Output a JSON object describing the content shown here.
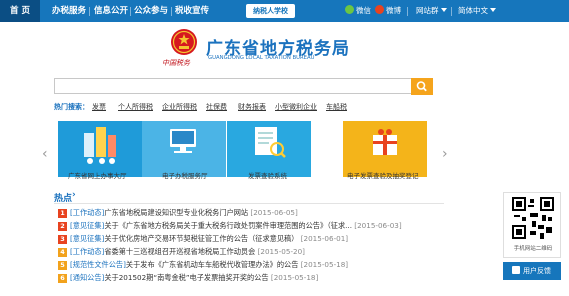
{
  "nav": {
    "items": [
      {
        "label": "首 页"
      },
      {
        "label": "办税服务"
      },
      {
        "label": "信息公开"
      },
      {
        "label": "公众参与"
      },
      {
        "label": "税收宣传"
      }
    ],
    "badge": "纳税人学校",
    "wechat": "微信",
    "weibo": "微博",
    "site_group": "网站群",
    "lang": "简体中文"
  },
  "logo": {
    "title_cn": "广东省地方税务局",
    "title_en": "GUANGDONG LOCAL TAXATION BUREAU",
    "brush": "中国税务"
  },
  "search": {
    "value": "",
    "icon": "search-icon"
  },
  "hot_search": {
    "label": "热门搜索：",
    "links": [
      "发票",
      "个人所得税",
      "企业所得税",
      "社保费",
      "财务报表",
      "小型微利企业",
      "车船税"
    ]
  },
  "tiles": [
    {
      "caption": "广东省网上办事大厅",
      "color": "#1f9bd9"
    },
    {
      "caption": "电子办税服务厅",
      "color": "#4bb4e6"
    },
    {
      "caption": "发票查验系统",
      "color": "#29a8e0"
    },
    {
      "caption": "电子发票查验及抽奖登记",
      "color": "#f4b41a"
    }
  ],
  "news": {
    "heading": "热点",
    "arrow": "›",
    "items": [
      {
        "num": "1",
        "category": "[工作动态]",
        "title": "广东省地税局建设知识型专业化税务门户网站",
        "date": "[2015-06-05]"
      },
      {
        "num": "2",
        "category": "[意见征集]",
        "title": "关于《广东省地方税务局关于重大税务行政处罚案件审理范围的公告》（征求...",
        "date": "[2015-06-03]"
      },
      {
        "num": "3",
        "category": "[意见征集]",
        "title": "关于优化房地产交易环节契税征管工作的公告（征求意见稿）",
        "date": "[2015-06-01]"
      },
      {
        "num": "4",
        "category": "[工作动态]",
        "title": "省委第十三巡视组召开巡视省地税局工作动员会",
        "date": "[2015-05-20]"
      },
      {
        "num": "5",
        "category": "[规范性文件公告]",
        "title": "关于发布《广东省机动车车船税代收管理办法》的公告",
        "date": "[2015-05-18]"
      },
      {
        "num": "6",
        "category": "[通知公告]",
        "title": "关于201502期“南粤金税”电子发票抽奖开奖的公告",
        "date": "[2015-05-18]"
      }
    ],
    "num_colors": [
      "#e8431f",
      "#e8431f",
      "#e8431f",
      "#f2a21c",
      "#f2a21c",
      "#f2a21c"
    ]
  },
  "sidebar": {
    "qr_caption": "手机网站二维码",
    "feedback_label": "用户反馈"
  },
  "colors": {
    "nav_bg": "#1676bc",
    "accent": "#1b72be",
    "search_button": "#f5a41c"
  }
}
